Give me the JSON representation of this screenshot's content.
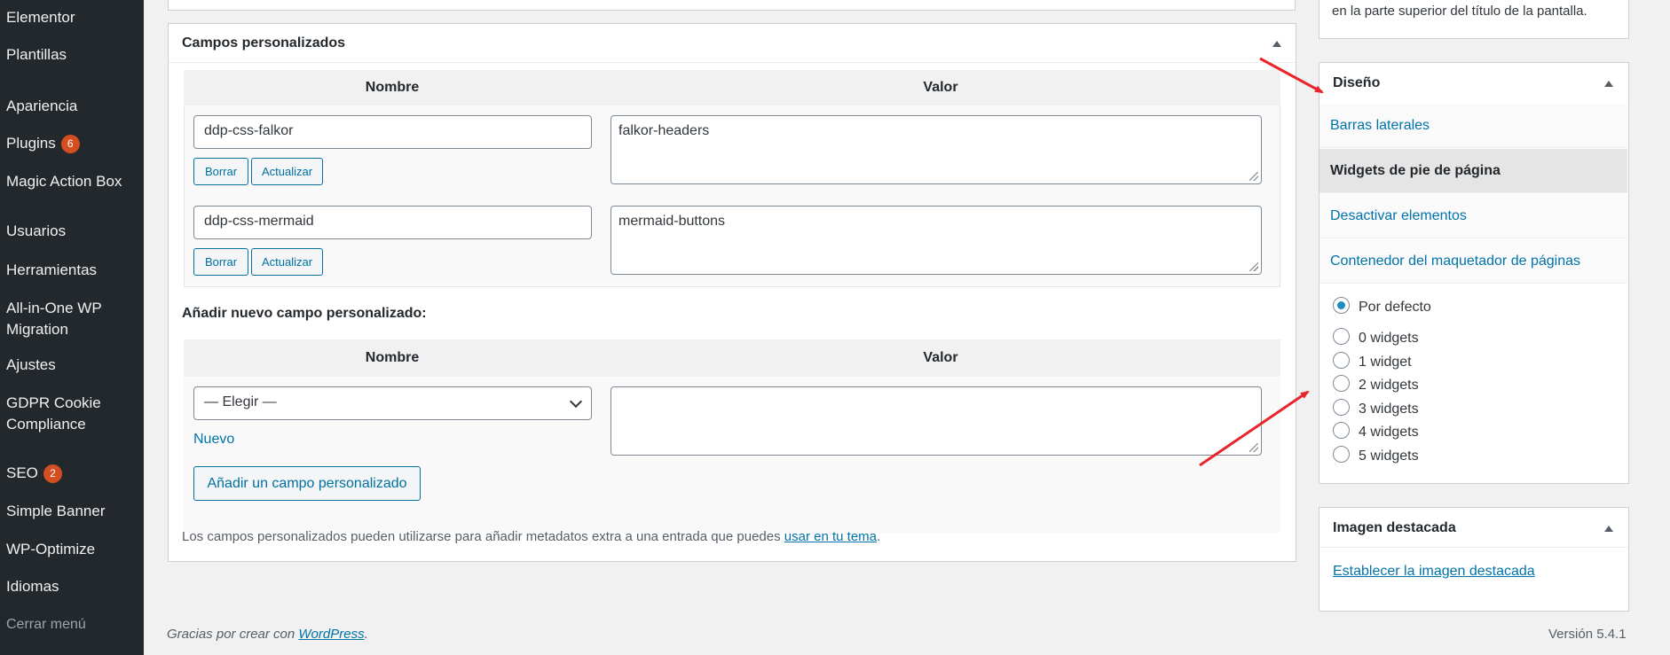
{
  "sidebar": {
    "items": [
      {
        "label": "Elementor"
      },
      {
        "label": "Plantillas"
      },
      {
        "label": "Apariencia"
      },
      {
        "label": "Plugins",
        "badge": "6"
      },
      {
        "label": "Magic Action Box"
      },
      {
        "label": "Usuarios"
      },
      {
        "label": "Herramientas"
      },
      {
        "label": "All-in-One WP Migration"
      },
      {
        "label": "Ajustes"
      },
      {
        "label": "GDPR Cookie Compliance"
      },
      {
        "label": "SEO",
        "badge": "2"
      },
      {
        "label": "Simple Banner"
      },
      {
        "label": "WP-Optimize"
      },
      {
        "label": "Idiomas"
      }
    ],
    "collapse_label": "Cerrar menú"
  },
  "custom_fields": {
    "title": "Campos personalizados",
    "col_name": "Nombre",
    "col_value": "Valor",
    "rows": [
      {
        "name": "ddp-css-falkor",
        "value": "falkor-headers"
      },
      {
        "name": "ddp-css-mermaid",
        "value": "mermaid-buttons"
      }
    ],
    "delete_label": "Borrar",
    "update_label": "Actualizar",
    "add_new_heading": "Añadir nuevo campo personalizado:",
    "select_value": "— Elegir —",
    "new_link": "Nuevo",
    "add_button": "Añadir un campo personalizado",
    "note_prefix": "Los campos personalizados pueden utilizarse para añadir metadatos extra a una entrada que puedes ",
    "note_link": "usar en tu tema",
    "note_suffix": "."
  },
  "help_snippet": "en la parte superior del título de la pantalla.",
  "design_panel": {
    "title": "Diseño",
    "tabs": [
      {
        "label": "Barras laterales",
        "active": false
      },
      {
        "label": "Widgets de pie de página",
        "active": true
      },
      {
        "label": "Desactivar elementos",
        "active": false
      },
      {
        "label": "Contenedor del maquetador de páginas",
        "active": false
      }
    ],
    "options": [
      {
        "label": "Por defecto",
        "checked": true
      },
      {
        "label": "0 widgets",
        "checked": false
      },
      {
        "label": "1 widget",
        "checked": false
      },
      {
        "label": "2 widgets",
        "checked": false
      },
      {
        "label": "3 widgets",
        "checked": false
      },
      {
        "label": "4 widgets",
        "checked": false
      },
      {
        "label": "5 widgets",
        "checked": false
      }
    ]
  },
  "featured_image": {
    "title": "Imagen destacada",
    "link": "Establecer la imagen destacada"
  },
  "footer": {
    "thanks_prefix": "Gracias por crear con ",
    "thanks_link": "WordPress",
    "thanks_suffix": ".",
    "version": "Versión 5.4.1"
  },
  "colors": {
    "annotation_arrow": "#e8252a",
    "link": "#0073aa",
    "sidebar_bg": "#23282d",
    "badge": "#d54e21"
  }
}
